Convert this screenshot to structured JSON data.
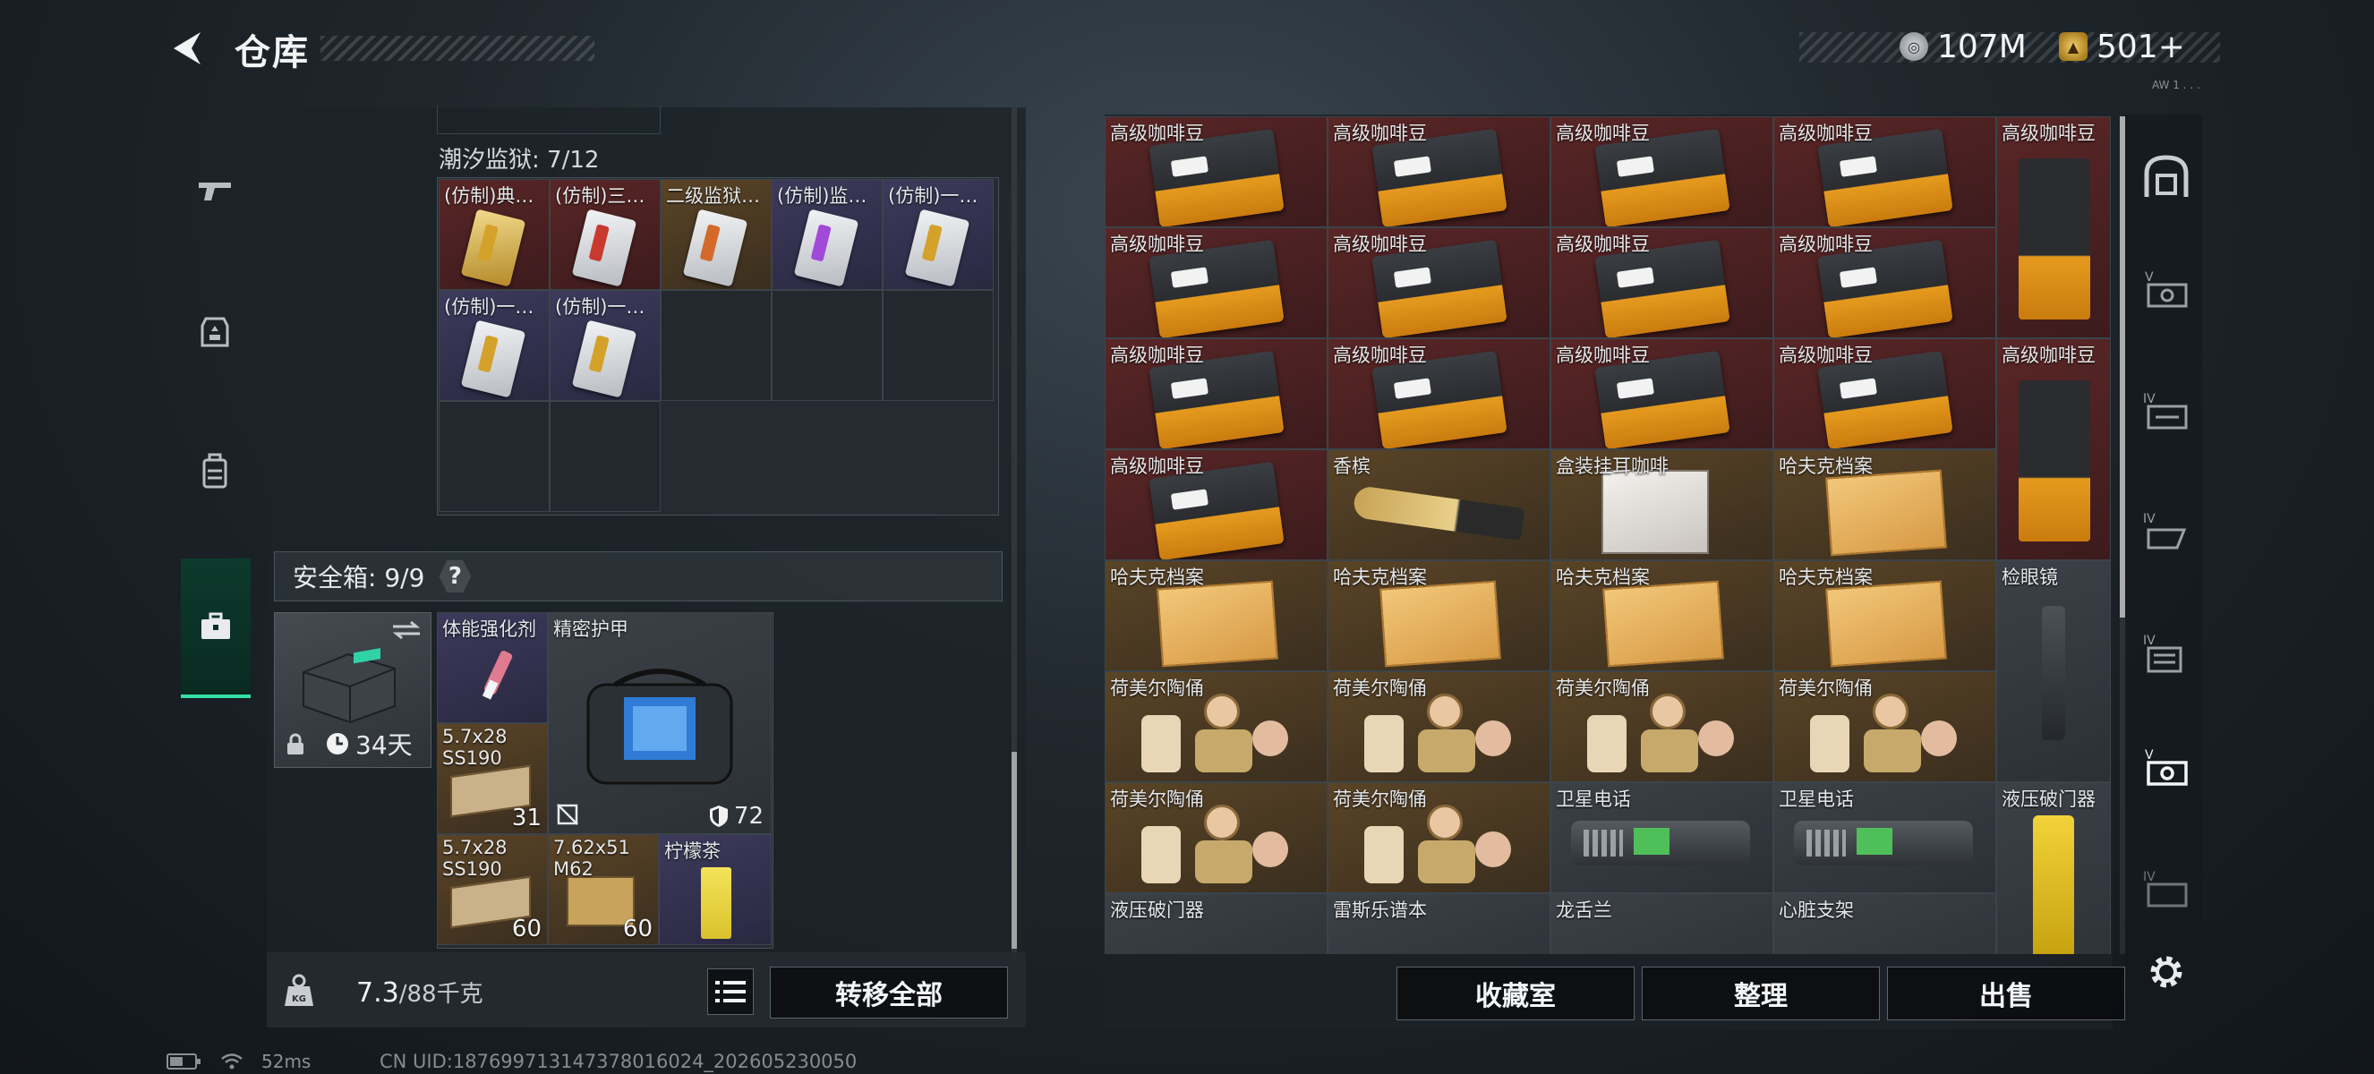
{
  "header": {
    "title": "仓库",
    "currency_coin": "107M",
    "currency_ticket": "501+",
    "version": "AW 1 . . .",
    "coin_glyph": "◎",
    "ticket_glyph": "▲"
  },
  "left_rail": {
    "items": [
      {
        "name": "weapons",
        "icon": "gun-icon",
        "active": false
      },
      {
        "name": "equipment",
        "icon": "helmet-icon",
        "active": false
      },
      {
        "name": "backpack",
        "icon": "backpack-icon",
        "active": false
      },
      {
        "name": "safe",
        "icon": "briefcase-icon",
        "active": true
      }
    ]
  },
  "container": {
    "label": "潮汐监狱: 7/12",
    "items": [
      {
        "name": "(仿制)典…",
        "bg": "red",
        "stripe": "#d4a12a",
        "gold": true
      },
      {
        "name": "(仿制)三…",
        "bg": "red",
        "stripe": "#c83a2e"
      },
      {
        "name": "二级监狱…",
        "bg": "gold",
        "stripe": "#d46a2a"
      },
      {
        "name": "(仿制)监…",
        "bg": "purple",
        "stripe": "#a14ad8"
      },
      {
        "name": "(仿制)一…",
        "bg": "purple",
        "stripe": "#d4a12a"
      },
      {
        "name": "(仿制)一…",
        "bg": "purple",
        "stripe": "#d4a12a"
      },
      {
        "name": "(仿制)一…",
        "bg": "purple",
        "stripe": "#d4a12a"
      }
    ]
  },
  "safe": {
    "label": "安全箱: 9/9",
    "help": "?",
    "case_days": "34天",
    "items": {
      "stim": "体能强化剂",
      "armor": "精密护甲",
      "armor_durability": "72",
      "ammo1_name": "5.7x28 SS190",
      "ammo1_count": "31",
      "ammo2_name": "5.7x28 SS190",
      "ammo2_count": "60",
      "ammo3_name": "7.62x51 M62",
      "ammo3_count": "60",
      "tea": "柠檬茶"
    }
  },
  "weight": {
    "current": "7.3",
    "max": "/88千克"
  },
  "buttons": {
    "transfer_all": "转移全部",
    "collection": "收藏室",
    "sort": "整理",
    "sell": "出售"
  },
  "warehouse": {
    "rows": [
      [
        "高级咖啡豆",
        "高级咖啡豆",
        "高级咖啡豆",
        "高级咖啡豆"
      ],
      [
        "高级咖啡豆",
        "高级咖啡豆",
        "高级咖啡豆",
        "高级咖啡豆"
      ],
      [
        "高级咖啡豆",
        "高级咖啡豆",
        "高级咖啡豆",
        "高级咖啡豆"
      ],
      [
        "高级咖啡豆",
        "香槟",
        "盒装挂耳咖啡",
        "哈夫克档案"
      ],
      [
        "哈夫克档案",
        "哈夫克档案",
        "哈夫克档案",
        "哈夫克档案"
      ],
      [
        "荷美尔陶俑",
        "荷美尔陶俑",
        "荷美尔陶俑",
        "荷美尔陶俑"
      ],
      [
        "荷美尔陶俑",
        "荷美尔陶俑",
        "卫星电话",
        "卫星电话"
      ],
      [
        "液压破门器",
        "雷斯乐谱本",
        "龙舌兰",
        "心脏支架"
      ]
    ],
    "tall_items": [
      "高级咖啡豆",
      "高级咖啡豆",
      "检眼镜",
      "液压破门器"
    ]
  },
  "status": {
    "ping": "52ms",
    "uid": "CN UID:18769971314737801602‌4_202605230050"
  }
}
